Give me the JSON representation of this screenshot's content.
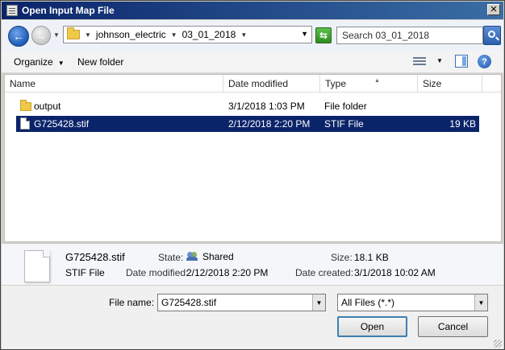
{
  "window": {
    "title": "Open Input Map File"
  },
  "address": {
    "crumbs": [
      "johnson_electric",
      "03_01_2018"
    ],
    "search_placeholder": "Search 03_01_2018"
  },
  "toolbar": {
    "organize": "Organize",
    "new_folder": "New folder"
  },
  "columns": {
    "name": "Name",
    "date": "Date modified",
    "type": "Type",
    "size": "Size"
  },
  "files": [
    {
      "name": "output",
      "date": "3/1/2018 1:03 PM",
      "type": "File folder",
      "size": "",
      "icon": "folder-icon"
    },
    {
      "name": "G725428.stif",
      "date": "2/12/2018 2:20 PM",
      "type": "STIF File",
      "size": "19 KB",
      "icon": "file-icon",
      "selected": true
    }
  ],
  "details": {
    "file_name": "G725428.stif",
    "file_type": "STIF File",
    "state_label": "State:",
    "state_value": "Shared",
    "size_label": "Size:",
    "size_value": "18.1 KB",
    "modified_label": "Date modified:",
    "modified_value": "2/12/2018 2:20 PM",
    "created_label": "Date created:",
    "created_value": "3/1/2018 10:02 AM"
  },
  "bottom": {
    "file_name_label": "File name:",
    "file_name_value": "G725428.stif",
    "file_type_value": "All Files (*.*)",
    "open_label": "Open",
    "cancel_label": "Cancel"
  },
  "colors": {
    "title_bar": "#0a246a",
    "selection": "#0a246a"
  }
}
